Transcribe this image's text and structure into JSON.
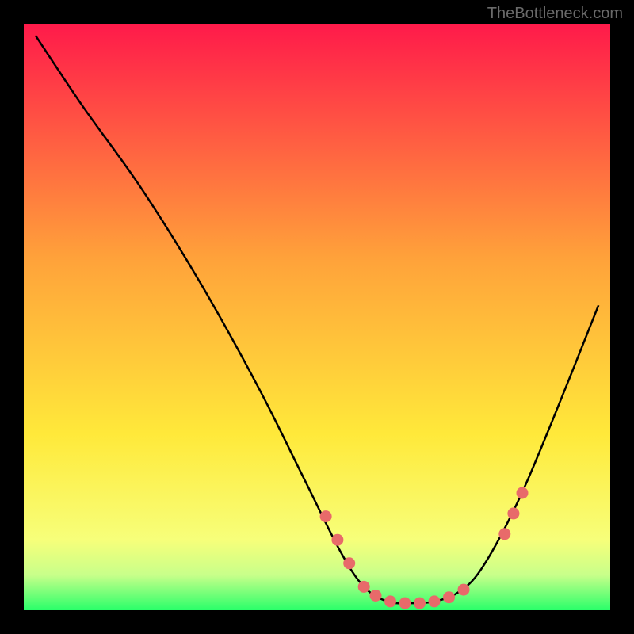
{
  "watermark": "TheBottleneck.com",
  "chart_data": {
    "type": "line",
    "title": "",
    "xlabel": "",
    "ylabel": "",
    "xlim": [
      0,
      100
    ],
    "ylim": [
      0,
      100
    ],
    "background_gradient": {
      "stops": [
        {
          "offset": 0,
          "color": "#ff1a4a"
        },
        {
          "offset": 40,
          "color": "#ffa23a"
        },
        {
          "offset": 70,
          "color": "#ffe93a"
        },
        {
          "offset": 88,
          "color": "#f7ff7a"
        },
        {
          "offset": 94,
          "color": "#c8ff8a"
        },
        {
          "offset": 100,
          "color": "#2aff6a"
        }
      ]
    },
    "curve": [
      {
        "x": 2,
        "y": 98
      },
      {
        "x": 10,
        "y": 86
      },
      {
        "x": 20,
        "y": 72
      },
      {
        "x": 30,
        "y": 56
      },
      {
        "x": 40,
        "y": 38
      },
      {
        "x": 48,
        "y": 22
      },
      {
        "x": 54,
        "y": 10
      },
      {
        "x": 58,
        "y": 4
      },
      {
        "x": 62,
        "y": 1.5
      },
      {
        "x": 66,
        "y": 1.2
      },
      {
        "x": 70,
        "y": 1.5
      },
      {
        "x": 74,
        "y": 3
      },
      {
        "x": 78,
        "y": 7
      },
      {
        "x": 84,
        "y": 18
      },
      {
        "x": 90,
        "y": 32
      },
      {
        "x": 98,
        "y": 52
      }
    ],
    "markers": [
      {
        "x": 51.5,
        "y": 16
      },
      {
        "x": 53.5,
        "y": 12
      },
      {
        "x": 55.5,
        "y": 8
      },
      {
        "x": 58,
        "y": 4
      },
      {
        "x": 60,
        "y": 2.5
      },
      {
        "x": 62.5,
        "y": 1.5
      },
      {
        "x": 65,
        "y": 1.2
      },
      {
        "x": 67.5,
        "y": 1.2
      },
      {
        "x": 70,
        "y": 1.5
      },
      {
        "x": 72.5,
        "y": 2.2
      },
      {
        "x": 75,
        "y": 3.5
      },
      {
        "x": 82,
        "y": 13
      },
      {
        "x": 83.5,
        "y": 16.5
      },
      {
        "x": 85,
        "y": 20
      }
    ],
    "marker_color": "#e86a6a",
    "curve_color": "#000000"
  }
}
